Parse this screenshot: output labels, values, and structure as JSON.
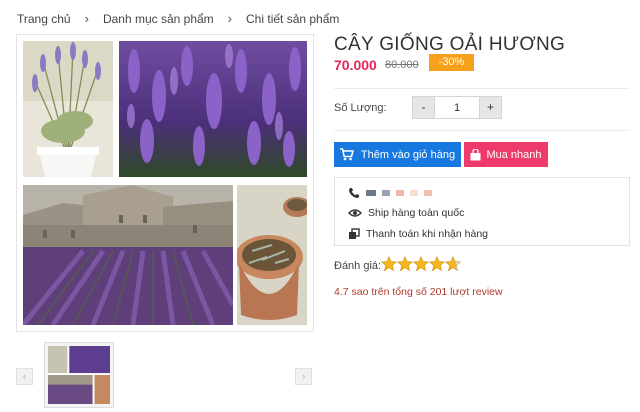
{
  "breadcrumb": {
    "home": "Trang chủ",
    "category": "Danh mục sản phẩm",
    "current": "Chi tiết sản phẩm",
    "separator": "›"
  },
  "product": {
    "title": "CÂY GIỐNG OẢI HƯƠNG",
    "price": "70.000",
    "old_price": "80.000",
    "discount": "-30%"
  },
  "quantity": {
    "label": "Số Lượng:",
    "minus": "-",
    "plus": "+",
    "value": "1"
  },
  "actions": {
    "add_to_cart": "Thêm vào giỏ hàng",
    "buy_now": "Mua nhanh"
  },
  "info": {
    "shipping": "Ship hàng toàn quốc",
    "payment": "Thanh toán khi nhận hàng"
  },
  "rating": {
    "label": "Đánh giá:",
    "stars": 4.7,
    "max": 5,
    "summary": "4.7 sao trên tổng số 201 lượt review"
  },
  "gallery": {
    "prev": "‹",
    "next": "›"
  },
  "colors": {
    "accent_blue": "#1778e0",
    "accent_pink": "#ef3b6b",
    "price": "#e8265a",
    "badge": "#f7a01b",
    "star": "#f5b51d"
  }
}
